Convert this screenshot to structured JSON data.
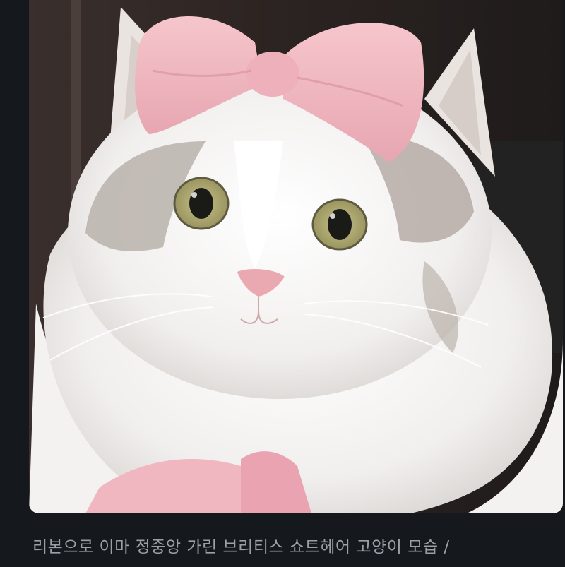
{
  "post": {
    "image": {
      "subject_icon": "cat-photo-icon"
    },
    "caption": "리본으로 이마 정중앙 가린 브리티스 쇼트헤어 고양이 모습 /"
  },
  "colors": {
    "background": "#15181d",
    "caption_text": "#9aa0a8",
    "ribbon": "#f1b9c1"
  }
}
